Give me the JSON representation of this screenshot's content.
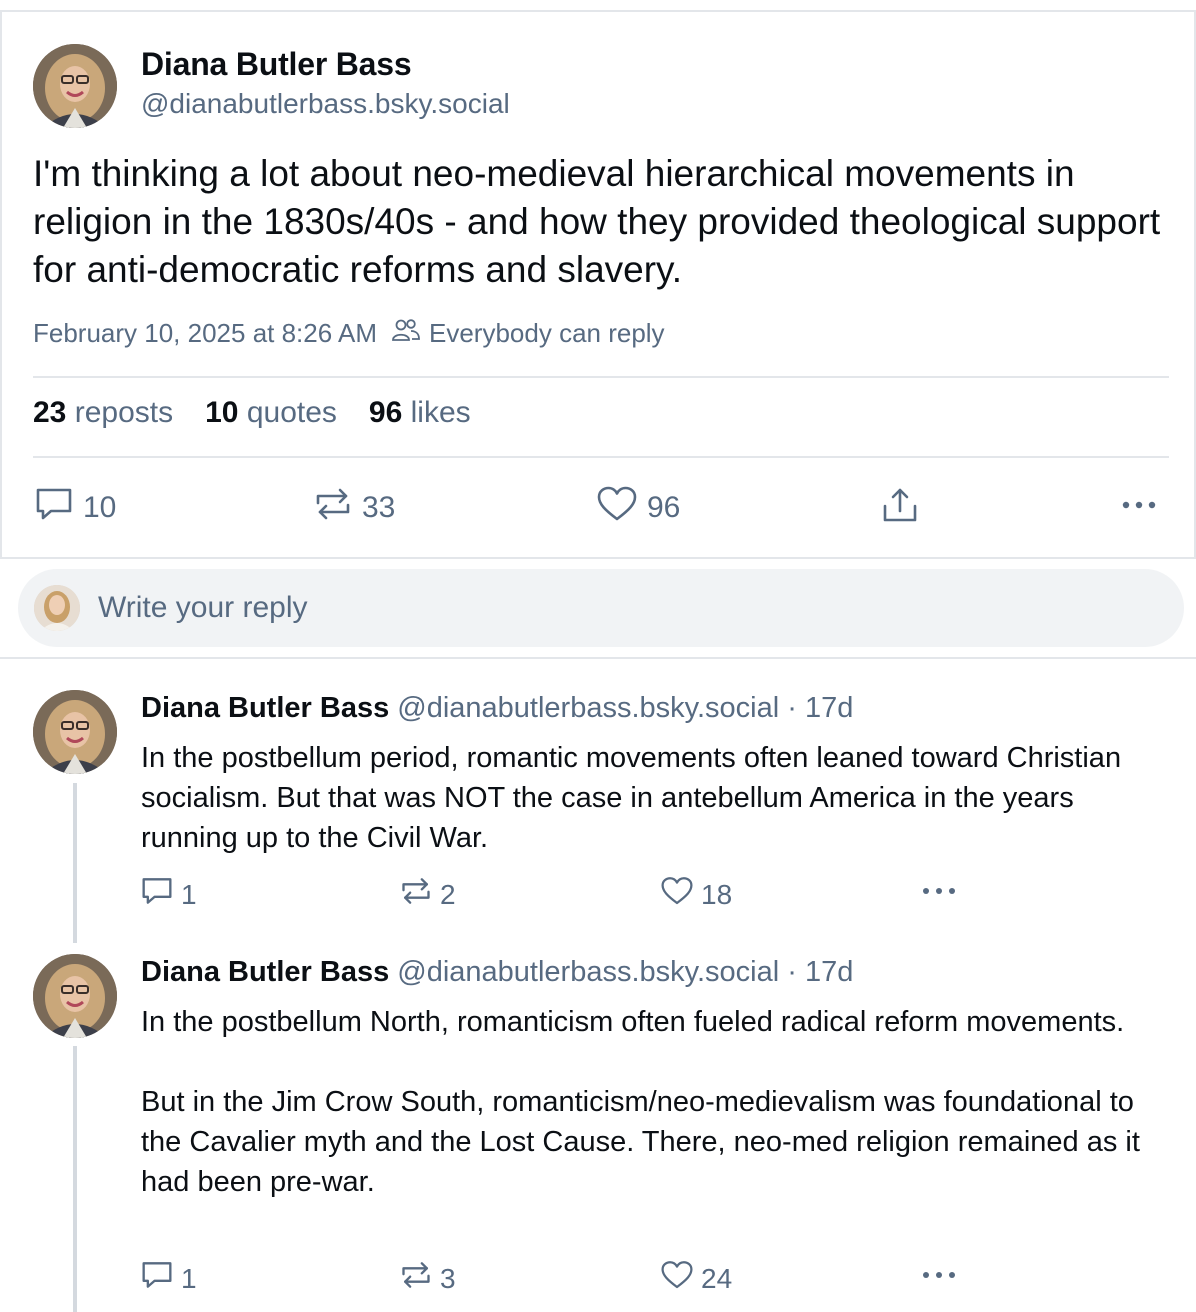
{
  "main_post": {
    "author_name": "Diana Butler Bass",
    "author_handle": "@dianabutlerbass.bsky.social",
    "text": "I'm thinking a lot about neo-medieval hierarchical movements in religion in the 1830s/40s - and how they provided theological support for anti-democratic reforms and slavery.",
    "timestamp": "February 10, 2025 at 8:26 AM",
    "reply_setting": "Everybody can reply",
    "stats": {
      "reposts_count": "23",
      "reposts_label": "reposts",
      "quotes_count": "10",
      "quotes_label": "quotes",
      "likes_count": "96",
      "likes_label": "likes"
    },
    "actions": {
      "replies": "10",
      "reposts": "33",
      "likes": "96"
    }
  },
  "composer": {
    "placeholder": "Write your reply"
  },
  "replies": [
    {
      "author_name": "Diana Butler Bass",
      "author_handle": "@dianabutlerbass.bsky.social",
      "age": "· 17d",
      "paragraphs": [
        "In the postbellum period, romantic movements often leaned toward Christian socialism. But that was NOT the case in antebellum America in the years running up to the Civil War."
      ],
      "actions": {
        "replies": "1",
        "reposts": "2",
        "likes": "18"
      }
    },
    {
      "author_name": "Diana Butler Bass",
      "author_handle": "@dianabutlerbass.bsky.social",
      "age": "· 17d",
      "paragraphs": [
        "In the postbellum North, romanticism often fueled radical reform movements.",
        "But in the Jim Crow South, romanticism/neo-medievalism was foundational to the Cavalier myth and the Lost Cause. There, neo-med religion remained as it had been pre-war."
      ],
      "actions": {
        "replies": "1",
        "reposts": "3",
        "likes": "24"
      }
    }
  ]
}
